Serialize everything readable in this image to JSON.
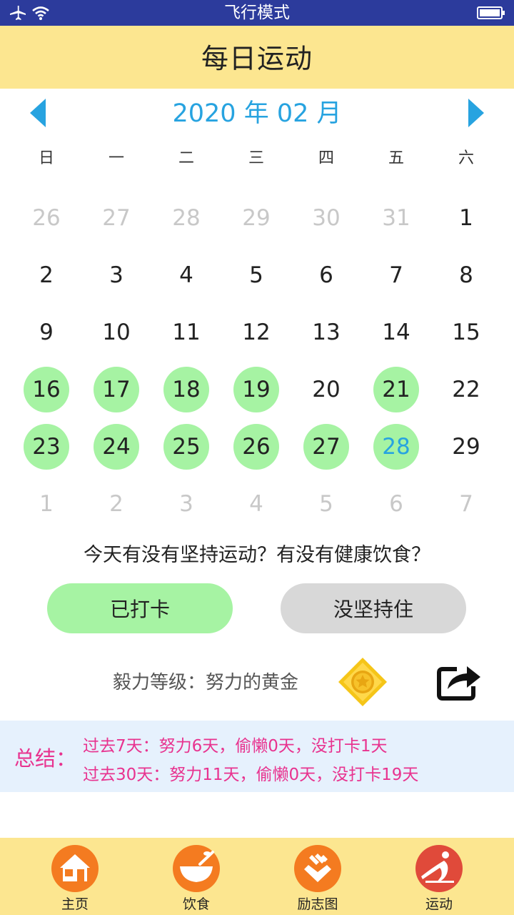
{
  "status_bar": {
    "mode_text": "飞行模式"
  },
  "header": {
    "title": "每日运动"
  },
  "calendar": {
    "month_label": "2020 年 02 月",
    "weekdays": [
      "日",
      "一",
      "二",
      "三",
      "四",
      "五",
      "六"
    ],
    "days": [
      {
        "n": "26",
        "state": "muted"
      },
      {
        "n": "27",
        "state": "muted"
      },
      {
        "n": "28",
        "state": "muted"
      },
      {
        "n": "29",
        "state": "muted"
      },
      {
        "n": "30",
        "state": "muted"
      },
      {
        "n": "31",
        "state": "muted"
      },
      {
        "n": "1",
        "state": "normal"
      },
      {
        "n": "2",
        "state": "normal"
      },
      {
        "n": "3",
        "state": "normal"
      },
      {
        "n": "4",
        "state": "normal"
      },
      {
        "n": "5",
        "state": "normal"
      },
      {
        "n": "6",
        "state": "normal"
      },
      {
        "n": "7",
        "state": "normal"
      },
      {
        "n": "8",
        "state": "normal"
      },
      {
        "n": "9",
        "state": "normal"
      },
      {
        "n": "10",
        "state": "normal"
      },
      {
        "n": "11",
        "state": "normal"
      },
      {
        "n": "12",
        "state": "normal"
      },
      {
        "n": "13",
        "state": "normal"
      },
      {
        "n": "14",
        "state": "normal"
      },
      {
        "n": "15",
        "state": "normal"
      },
      {
        "n": "16",
        "state": "done"
      },
      {
        "n": "17",
        "state": "done"
      },
      {
        "n": "18",
        "state": "done"
      },
      {
        "n": "19",
        "state": "done"
      },
      {
        "n": "20",
        "state": "normal"
      },
      {
        "n": "21",
        "state": "done"
      },
      {
        "n": "22",
        "state": "normal"
      },
      {
        "n": "23",
        "state": "done"
      },
      {
        "n": "24",
        "state": "done"
      },
      {
        "n": "25",
        "state": "done"
      },
      {
        "n": "26",
        "state": "done"
      },
      {
        "n": "27",
        "state": "done"
      },
      {
        "n": "28",
        "state": "done today"
      },
      {
        "n": "29",
        "state": "normal"
      },
      {
        "n": "1",
        "state": "muted"
      },
      {
        "n": "2",
        "state": "muted"
      },
      {
        "n": "3",
        "state": "muted"
      },
      {
        "n": "4",
        "state": "muted"
      },
      {
        "n": "5",
        "state": "muted"
      },
      {
        "n": "6",
        "state": "muted"
      },
      {
        "n": "7",
        "state": "muted"
      }
    ]
  },
  "question": "今天有没有坚持运动？有没有健康饮食？",
  "buttons": {
    "checked_in": "已打卡",
    "gave_up": "没坚持住"
  },
  "level": {
    "text": "毅力等级：努力的黄金"
  },
  "summary": {
    "label": "总结：",
    "line1": "过去7天：努力6天，偷懒0天，没打卡1天",
    "line2": "过去30天：努力11天，偷懒0天，没打卡19天"
  },
  "bottom_nav": [
    {
      "label": "主页",
      "icon": "house-icon"
    },
    {
      "label": "饮食",
      "icon": "bowl-icon"
    },
    {
      "label": "励志图",
      "icon": "motivation-icon"
    },
    {
      "label": "运动",
      "icon": "yoga-icon"
    }
  ],
  "colors": {
    "status_bar": "#2c3b9c",
    "header": "#fce690",
    "accent_blue": "#27a3e0",
    "done_green": "#a6f3a3",
    "summary_bg": "#e6f1fd",
    "summary_text": "#e8338f",
    "nav_orange": "#f47b20",
    "nav_active": "#e04a3a"
  }
}
